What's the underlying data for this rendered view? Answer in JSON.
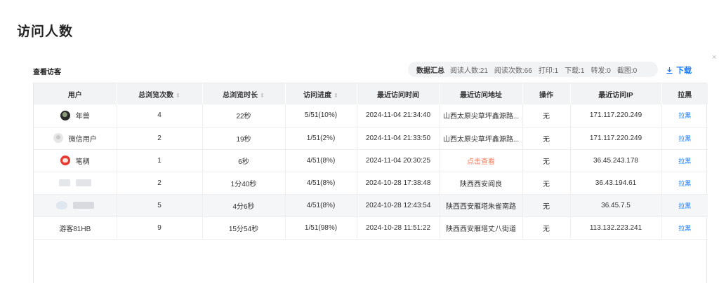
{
  "page_title": "访问人数",
  "close_glyph": "×",
  "panel_title": "查看访客",
  "summary": {
    "label": "数据汇总",
    "items": [
      "阅读人数:21",
      "阅读次数:66",
      "打印:1",
      "下载:1",
      "转发:0",
      "截图:0"
    ]
  },
  "download_label": "下载",
  "table": {
    "headers": [
      "用户",
      "总浏览次数",
      "总浏览时长",
      "访问进度",
      "最近访问时间",
      "最近访问地址",
      "操作",
      "最近访问IP",
      "拉黑"
    ],
    "rows": [
      {
        "user": "年兽",
        "views": "4",
        "duration": "22秒",
        "progress": "5/51(10%)",
        "time": "2024-11-04 21:34:40",
        "address": "山西太原尖草坪鑫源路...",
        "action": "无",
        "ip": "171.117.220.249",
        "block": "拉黑"
      },
      {
        "user": "微信用户",
        "views": "2",
        "duration": "19秒",
        "progress": "1/51(2%)",
        "time": "2024-11-04 21:33:50",
        "address": "山西太原尖草坪鑫源路...",
        "action": "无",
        "ip": "171.117.220.249",
        "block": "拉黑"
      },
      {
        "user": "笔稠",
        "views": "1",
        "duration": "6秒",
        "progress": "4/51(8%)",
        "time": "2024-11-04 20:30:25",
        "address": "点击查看",
        "action": "无",
        "ip": "36.45.243.178",
        "block": "拉黑"
      },
      {
        "user": "",
        "views": "2",
        "duration": "1分40秒",
        "progress": "4/51(8%)",
        "time": "2024-10-28 17:38:48",
        "address": "陕西西安阎良",
        "action": "无",
        "ip": "36.43.194.61",
        "block": "拉黑"
      },
      {
        "user": "",
        "views": "5",
        "duration": "4分6秒",
        "progress": "4/51(8%)",
        "time": "2024-10-28 12:43:54",
        "address": "陕西西安雁塔朱雀南路",
        "action": "无",
        "ip": "36.45.7.5",
        "block": "拉黑"
      },
      {
        "user": "游客81HB",
        "views": "9",
        "duration": "15分54秒",
        "progress": "1/51(98%)",
        "time": "2024-10-28 11:51:22",
        "address": "陕西西安雁塔丈八街道",
        "action": "无",
        "ip": "113.132.223.241",
        "block": "拉黑"
      }
    ]
  },
  "colors": {
    "accent": "#1677ff",
    "link_red": "#f5785a",
    "header_bg": "#f2f3f5"
  },
  "icons": {
    "download": "download-icon",
    "sort": "sort-icon",
    "close": "close-icon"
  }
}
